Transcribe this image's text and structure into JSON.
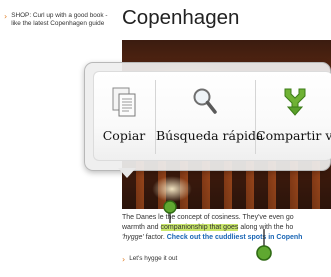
{
  "sidebar": {
    "shop_text": "SHOP: Curl up with a good book - like the latest Copenhagen guide"
  },
  "article": {
    "title": "Copenhagen",
    "para_l1_a": "The Danes l",
    "para_l1_b": "e the concept of cosiness. They've even go",
    "para_l2_a": "warmth and ",
    "para_l2_hl": "companionship that goes",
    "para_l2_b": " along with the ho",
    "para_l3_a": "'hygge'",
    "para_l3_b": " factor. ",
    "para_l3_link": "Check out the cuddliest spots in Copenh",
    "lets_hygge": "Let's hygge it out"
  },
  "quick_actions": [
    {
      "label": "Copiar",
      "icon": "copy-icon"
    },
    {
      "label": "Búsqueda rápida",
      "icon": "magnifier-icon"
    },
    {
      "label": "Compartir vía",
      "icon": "share-icon"
    }
  ],
  "colors": {
    "accent_orange": "#e07a1f",
    "link_blue": "#1a66b5",
    "selection_highlight": "#c8e66a",
    "handle_green": "#3c8a1e"
  }
}
